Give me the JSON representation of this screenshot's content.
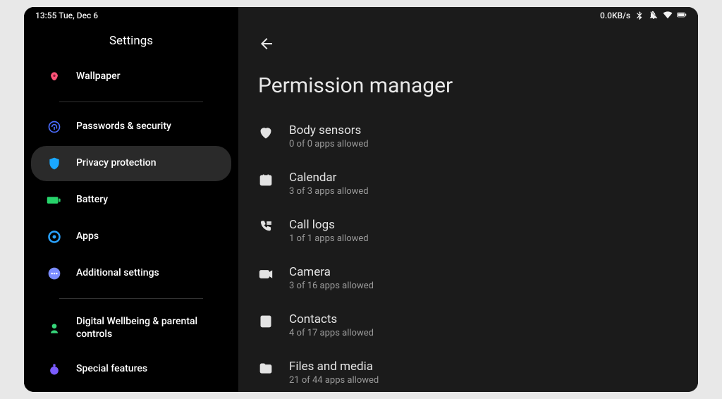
{
  "statusbar": {
    "time_date": "13:55  Tue, Dec 6",
    "net_rate": "0.0KB/s"
  },
  "sidebar": {
    "title": "Settings",
    "items": [
      {
        "label": "Wallpaper"
      },
      {
        "label": "Passwords & security"
      },
      {
        "label": "Privacy protection"
      },
      {
        "label": "Battery"
      },
      {
        "label": "Apps"
      },
      {
        "label": "Additional settings"
      },
      {
        "label": "Digital Wellbeing & parental controls"
      },
      {
        "label": "Special features"
      }
    ]
  },
  "main": {
    "title": "Permission manager",
    "permissions": [
      {
        "title": "Body sensors",
        "sub": "0 of 0 apps allowed"
      },
      {
        "title": "Calendar",
        "sub": "3 of 3 apps allowed"
      },
      {
        "title": "Call logs",
        "sub": "1 of 1 apps allowed"
      },
      {
        "title": "Camera",
        "sub": "3 of 16 apps allowed"
      },
      {
        "title": "Contacts",
        "sub": "4 of 17 apps allowed"
      },
      {
        "title": "Files and media",
        "sub": "21 of 44 apps allowed"
      }
    ]
  }
}
